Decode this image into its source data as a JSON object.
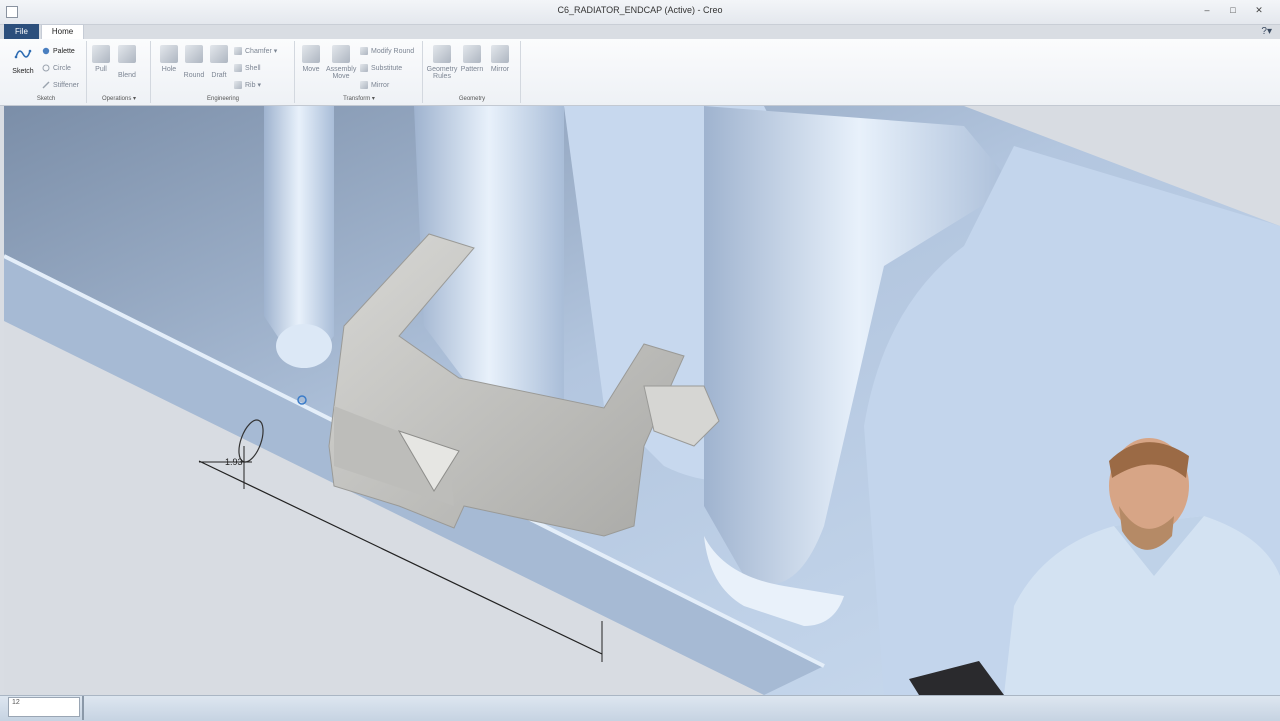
{
  "window": {
    "title": "C6_RADIATOR_ENDCAP (Active) - Creo",
    "controls": [
      "–",
      "□",
      "✕"
    ],
    "help": "?▾"
  },
  "tabs": [
    {
      "label": "File"
    },
    {
      "label": "Home"
    }
  ],
  "ribbon": {
    "sketch": {
      "sketch_label": "Sketch",
      "palette_label": "Palette",
      "circle_label": "Circle",
      "stiffener_label": "Stiffener",
      "group_label": "Sketch"
    },
    "operations": {
      "pull_label": "Pull",
      "blend_label": "Blend",
      "group_label": "Operations ▾"
    },
    "engineering": {
      "hole_label": "Hole",
      "round_label": "Round",
      "draft_label": "Draft",
      "chamfer_label": "Chamfer ▾",
      "shell_label": "Shell",
      "rib_label": "Rib ▾",
      "group_label": "Engineering"
    },
    "transform": {
      "move_label": "Move",
      "assembly_move_label": "Assembly Move",
      "modify_round_label": "Modify Round",
      "substitute_label": "Substitute",
      "mirror_label": "Mirror",
      "group_label": "Transform ▾"
    },
    "geometry": {
      "geometry_rules_label": "Geometry Rules",
      "pattern_label": "Pattern",
      "mirror_label": "Mirror",
      "group_label": "Geometry"
    }
  },
  "graphics": {
    "dimension_value": "1.93"
  },
  "statusbar": {
    "input_value": "12"
  },
  "colors": {
    "file_tab": "#2c4f7c",
    "model_surface": "#b9cde6",
    "clip_surface": "#c6c6c3",
    "background": "#d9dde3"
  }
}
